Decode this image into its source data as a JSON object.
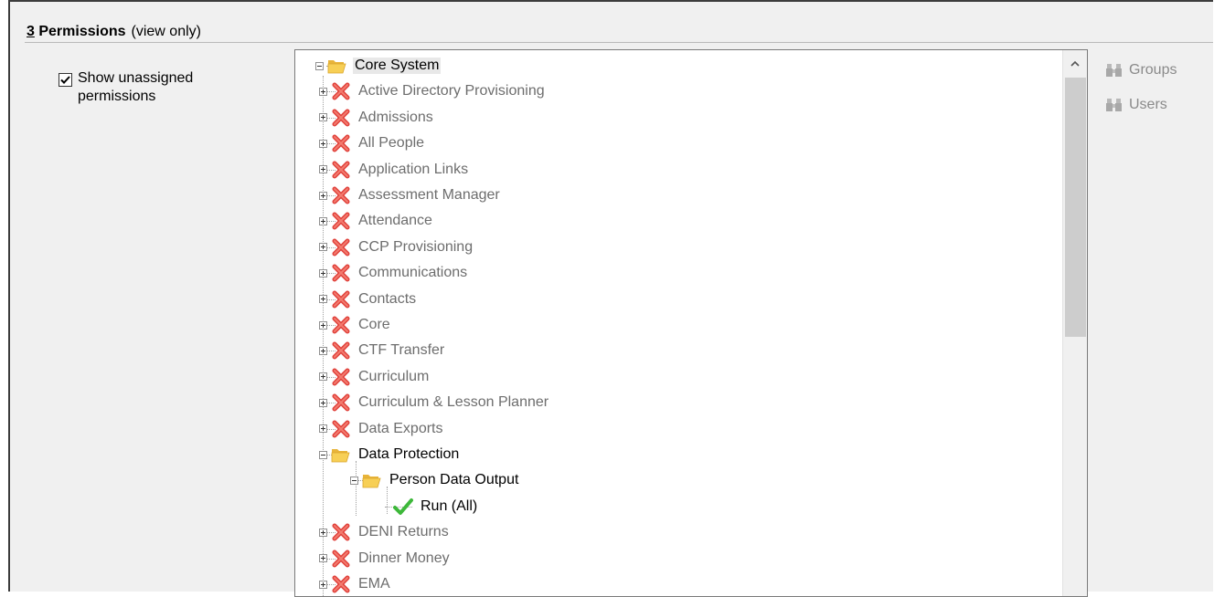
{
  "section": {
    "number": "3",
    "title": " Permissions",
    "subtitle": "(view only)"
  },
  "show_unassigned": {
    "checked": true,
    "label": "Show unassigned permissions"
  },
  "tree": {
    "root": {
      "label": "Core System",
      "expanded": true,
      "icon": "folder-open-icon"
    },
    "items": [
      {
        "label": "Active Directory Provisioning",
        "status": "unassigned"
      },
      {
        "label": "Admissions",
        "status": "unassigned"
      },
      {
        "label": "All People",
        "status": "unassigned"
      },
      {
        "label": "Application Links",
        "status": "unassigned"
      },
      {
        "label": "Assessment Manager",
        "status": "unassigned"
      },
      {
        "label": "Attendance",
        "status": "unassigned"
      },
      {
        "label": "CCP Provisioning",
        "status": "unassigned"
      },
      {
        "label": "Communications",
        "status": "unassigned"
      },
      {
        "label": "Contacts",
        "status": "unassigned"
      },
      {
        "label": "Core",
        "status": "unassigned"
      },
      {
        "label": "CTF Transfer",
        "status": "unassigned"
      },
      {
        "label": "Curriculum",
        "status": "unassigned"
      },
      {
        "label": "Curriculum & Lesson Planner",
        "status": "unassigned"
      },
      {
        "label": "Data Exports",
        "status": "unassigned"
      },
      {
        "label": "Data Protection",
        "status": "assigned-folder",
        "expanded": true
      },
      {
        "label": "Person Data Output",
        "status": "assigned-folder",
        "expanded": true
      },
      {
        "label": "Run (All)",
        "status": "granted"
      },
      {
        "label": "DENI Returns",
        "status": "unassigned"
      },
      {
        "label": "Dinner Money",
        "status": "unassigned"
      },
      {
        "label": "EMA",
        "status": "unassigned"
      }
    ]
  },
  "side_buttons": {
    "groups": "Groups",
    "users": "Users"
  },
  "colors": {
    "panel_bg": "#f0f0f0",
    "unassigned_text": "#6d6d6d",
    "cross_red": "#e0403a",
    "check_green": "#3db83a",
    "folder_yellow": "#f5c542"
  }
}
